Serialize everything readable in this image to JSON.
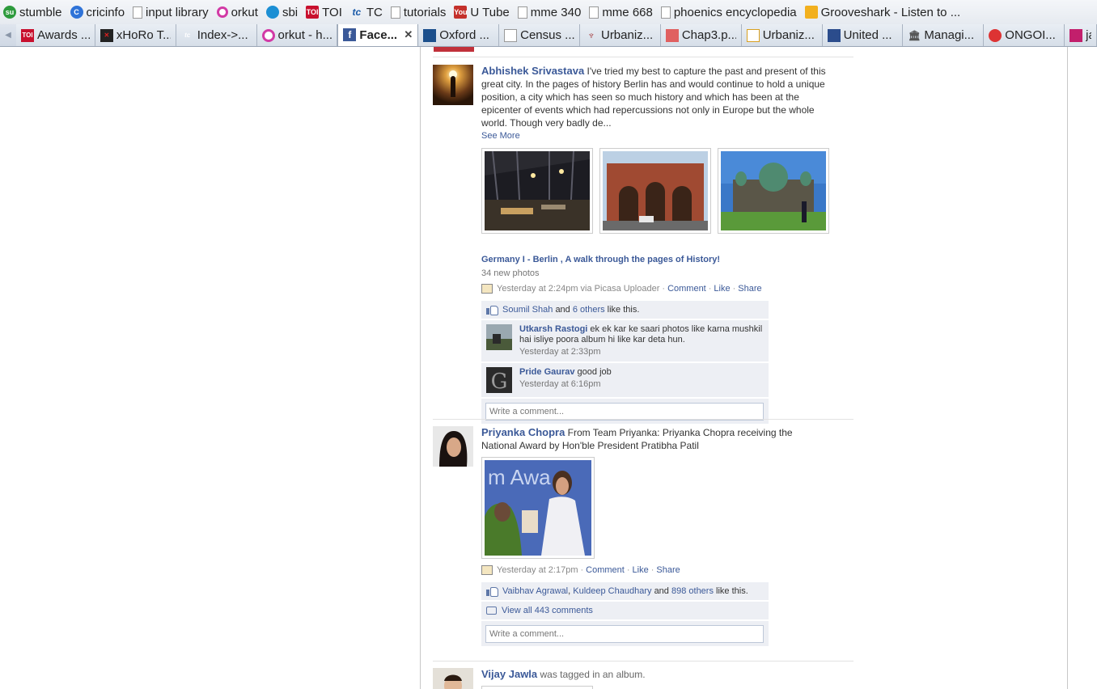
{
  "bookmarks": [
    {
      "label": "stumble",
      "icon": "stumbleupon-icon"
    },
    {
      "label": "cricinfo",
      "icon": "cricinfo-icon"
    },
    {
      "label": "input library",
      "icon": "page-icon"
    },
    {
      "label": "orkut",
      "icon": "orkut-icon"
    },
    {
      "label": "sbi",
      "icon": "sbi-icon"
    },
    {
      "label": "TOI",
      "icon": "toi-icon"
    },
    {
      "label": "TC",
      "icon": "tc-icon"
    },
    {
      "label": "tutorials",
      "icon": "page-icon"
    },
    {
      "label": "U Tube",
      "icon": "youtube-icon"
    },
    {
      "label": "mme 340",
      "icon": "page-icon"
    },
    {
      "label": "mme 668",
      "icon": "page-icon"
    },
    {
      "label": "phoenics encyclopedia",
      "icon": "page-icon"
    },
    {
      "label": "Grooveshark - Listen to ...",
      "icon": "grooveshark-icon"
    }
  ],
  "tabs": [
    {
      "label": "Awards ...",
      "icon": "toi-icon"
    },
    {
      "label": "xHoRo T...",
      "icon": "xhoro-icon"
    },
    {
      "label": "Index->...",
      "icon": "tc-icon"
    },
    {
      "label": "orkut - h...",
      "icon": "orkut-icon"
    },
    {
      "label": "Face...",
      "icon": "facebook-icon",
      "active": true
    },
    {
      "label": "Oxford ...",
      "icon": "oxford-icon"
    },
    {
      "label": "Census ...",
      "icon": "page-icon"
    },
    {
      "label": "Urbaniz...",
      "icon": "urbanization-icon"
    },
    {
      "label": "Chap3.p...",
      "icon": "pdf-icon"
    },
    {
      "label": "Urbaniz...",
      "icon": "page-icon"
    },
    {
      "label": "United ...",
      "icon": "un-icon"
    },
    {
      "label": "Managi...",
      "icon": "building-icon"
    },
    {
      "label": "ONGOI...",
      "icon": "ongoing-icon"
    },
    {
      "label": "ja",
      "icon": "ja-icon"
    }
  ],
  "post1": {
    "actor": "Abhishek Srivastava",
    "message": "I've tried my best to capture the past and present of this great city. In the pages of history Berlin has and would continue to hold a unique position, a city which has seen so much history and which has been at the epicenter of events which had repercussions not only in Europe but the whole world. Though very badly de...",
    "see_more": "See More",
    "album_title": "Germany I - Berlin , A walk through the pages of History!",
    "album_sub": "34 new photos",
    "time": "Yesterday at 2:24pm via Picasa Uploader",
    "comment": "Comment",
    "like": "Like",
    "share": "Share",
    "likes": {
      "name": "Soumil Shah",
      "and": "and",
      "others": "6 others",
      "tail": "like this."
    },
    "comments": [
      {
        "name": "Utkarsh Rastogi",
        "text": "ek ek kar ke saari photos like karna mushkil hai isliye poora album hi like kar deta hun.",
        "time": "Yesterday at 2:33pm"
      },
      {
        "name": "Pride Gaurav",
        "text": "good job",
        "time": "Yesterday at 6:16pm"
      }
    ],
    "write_placeholder": "Write a comment..."
  },
  "post2": {
    "actor": "Priyanka Chopra",
    "message": "From Team Priyanka: Priyanka Chopra receiving the National Award by Hon'ble President Pratibha Patil",
    "time": "Yesterday at 2:17pm",
    "comment": "Comment",
    "like": "Like",
    "share": "Share",
    "likes": {
      "name1": "Vaibhav Agrawal",
      "comma": ",",
      "name2": "Kuldeep Chaudhary",
      "and": "and",
      "others": "898 others",
      "tail": "like this."
    },
    "view_all": "View all 443 comments",
    "write_placeholder": "Write a comment...",
    "photo_caption": "m Awa"
  },
  "post3": {
    "actor": "Vijay Jawla",
    "message": "was tagged in an album."
  },
  "colors": {
    "fb_blue": "#3b5998",
    "ufi_bg": "#edeff4"
  }
}
